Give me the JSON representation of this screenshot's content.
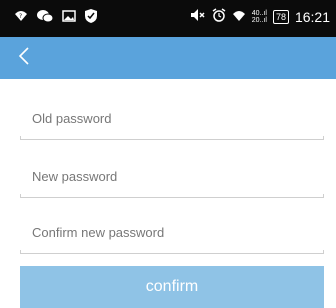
{
  "status_bar": {
    "time": "16:21",
    "battery_level": "78",
    "network_speed_top": "40..ıl",
    "network_speed_bottom": "20..ıl",
    "left_icons": [
      "wifi-question-icon",
      "wechat-icon",
      "image-icon",
      "shield-icon"
    ],
    "right_icons": [
      "mute-icon",
      "alarm-icon",
      "wifi-icon",
      "signal-icon",
      "battery-icon"
    ]
  },
  "app_bar": {
    "background_color": "#5aa3dc",
    "back_icon": "chevron-left-icon"
  },
  "form": {
    "old_password": {
      "value": "",
      "placeholder": "Old password"
    },
    "new_password": {
      "value": "",
      "placeholder": "New password"
    },
    "confirm_password": {
      "value": "",
      "placeholder": "Confirm new password"
    },
    "confirm_label": "confirm",
    "confirm_color": "#8fc3e6"
  }
}
